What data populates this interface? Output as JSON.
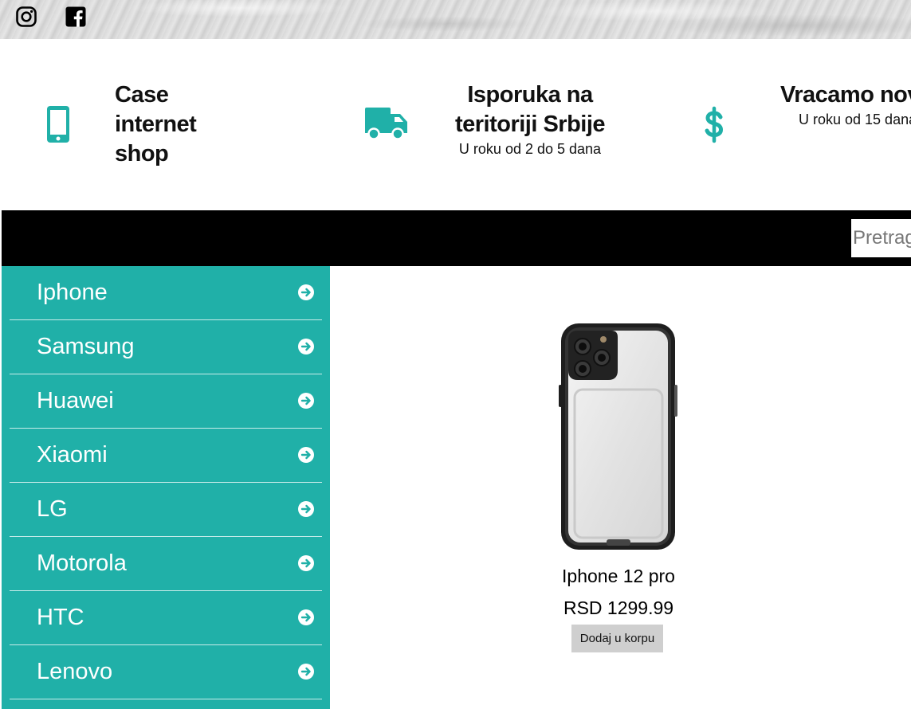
{
  "social": {
    "icons": [
      "instagram-icon",
      "facebook-icon"
    ]
  },
  "features": [
    {
      "icon": "phone-icon",
      "title_lines": [
        "Case",
        "internet",
        "shop"
      ],
      "subtitle": ""
    },
    {
      "icon": "truck-icon",
      "title_lines": [
        "Isporuka na",
        "teritoriji Srbije"
      ],
      "subtitle": "U roku od 2 do 5 dana"
    },
    {
      "icon": "dollar-icon",
      "title_lines": [
        "Vracamo nov"
      ],
      "subtitle": "U roku od 15 dana"
    }
  ],
  "search": {
    "placeholder": "Pretraga"
  },
  "sidebar": {
    "items": [
      {
        "label": "Iphone"
      },
      {
        "label": "Samsung"
      },
      {
        "label": "Huawei"
      },
      {
        "label": "Xiaomi"
      },
      {
        "label": "LG"
      },
      {
        "label": "Motorola"
      },
      {
        "label": "HTC"
      },
      {
        "label": "Lenovo"
      }
    ]
  },
  "product": {
    "name": "Iphone 12 pro",
    "price": "RSD 1299.99",
    "button_label": "Dodaj u korpu"
  },
  "colors": {
    "accent": "#20b0a8",
    "bar": "#000000"
  }
}
